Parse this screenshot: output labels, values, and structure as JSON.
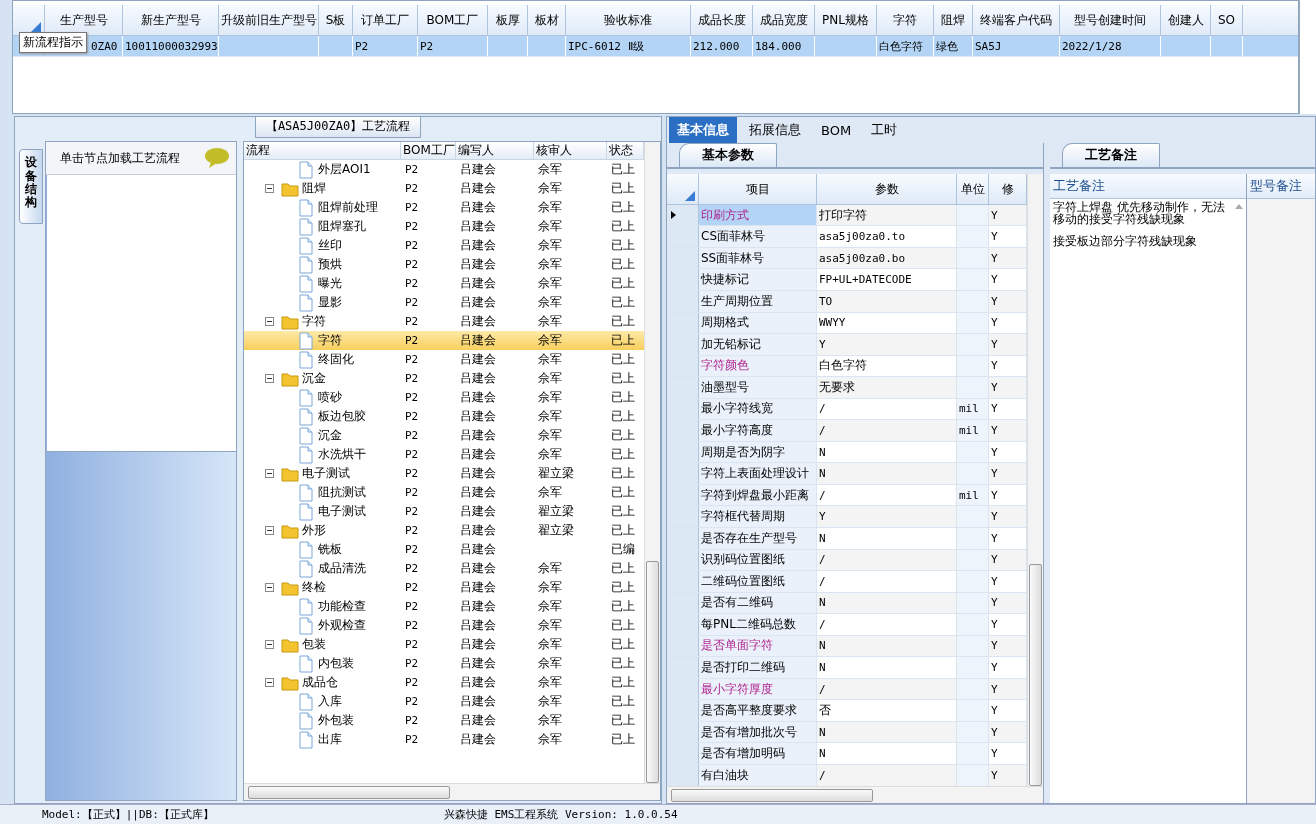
{
  "grid": {
    "columns": [
      "生产型号",
      "新生产型号",
      "升级前旧生产型号",
      "S板",
      "订单工厂",
      "BOM工厂",
      "板厚",
      "板材",
      "验收标准",
      "成品长度",
      "成品宽度",
      "PNL规格",
      "字符",
      "阻焊",
      "终端客户代码",
      "型号创建时间",
      "创建人",
      "SO"
    ],
    "rows": [
      {
        "selected": true,
        "cells": [
          "0ZA0",
          "10011000032993",
          null,
          null,
          "P2",
          "P2",
          null,
          null,
          "IPC-6012 Ⅱ级",
          "212.000",
          "184.000",
          null,
          "白色字符",
          "绿色",
          "SA5J",
          "2022/1/28",
          null,
          null
        ]
      }
    ]
  },
  "tooltip": {
    "text": "新流程指示"
  },
  "flow_panel": {
    "title": "【ASA5J00ZA0】工艺流程",
    "side_tab": "设备结构",
    "hint": "单击节点加载工艺流程",
    "tree": {
      "columns": [
        "流程",
        "BOM工厂",
        "编写人",
        "核审人",
        "状态"
      ],
      "rows": [
        {
          "children": [
            {
              "label": "外层AOI1",
              "bom": "P2",
              "author": "吕建会",
              "reviewer": "佘军",
              "status": "已上",
              "selected": false
            }
          ]
        },
        {
          "label": "阻焊",
          "bom": "P2",
          "author": "吕建会",
          "reviewer": "佘军",
          "status": "已上",
          "selected": false,
          "expanded": true,
          "children": [
            {
              "label": "阻焊前处理",
              "bom": "P2",
              "author": "吕建会",
              "reviewer": "佘军",
              "status": "已上",
              "selected": false
            },
            {
              "label": "阻焊塞孔",
              "bom": "P2",
              "author": "吕建会",
              "reviewer": "佘军",
              "status": "已上",
              "selected": false
            },
            {
              "label": "丝印",
              "bom": "P2",
              "author": "吕建会",
              "reviewer": "佘军",
              "status": "已上",
              "selected": false
            },
            {
              "label": "预烘",
              "bom": "P2",
              "author": "吕建会",
              "reviewer": "佘军",
              "status": "已上",
              "selected": false
            },
            {
              "label": "曝光",
              "bom": "P2",
              "author": "吕建会",
              "reviewer": "佘军",
              "status": "已上",
              "selected": false
            },
            {
              "label": "显影",
              "bom": "P2",
              "author": "吕建会",
              "reviewer": "佘军",
              "status": "已上",
              "selected": false
            }
          ]
        },
        {
          "label": "字符",
          "bom": "P2",
          "author": "吕建会",
          "reviewer": "佘军",
          "status": "已上",
          "selected": false,
          "expanded": true,
          "children": [
            {
              "label": "字符",
              "bom": "P2",
              "author": "吕建会",
              "reviewer": "佘军",
              "status": "已上",
              "selected": true
            },
            {
              "label": "终固化",
              "bom": "P2",
              "author": "吕建会",
              "reviewer": "佘军",
              "status": "已上",
              "selected": false
            }
          ]
        },
        {
          "label": "沉金",
          "bom": "P2",
          "author": "吕建会",
          "reviewer": "佘军",
          "status": "已上",
          "selected": false,
          "expanded": true,
          "children": [
            {
              "label": "喷砂",
              "bom": "P2",
              "author": "吕建会",
              "reviewer": "佘军",
              "status": "已上",
              "selected": false
            },
            {
              "label": "板边包胶",
              "bom": "P2",
              "author": "吕建会",
              "reviewer": "佘军",
              "status": "已上",
              "selected": false
            },
            {
              "label": "沉金",
              "bom": "P2",
              "author": "吕建会",
              "reviewer": "佘军",
              "status": "已上",
              "selected": false
            },
            {
              "label": "水洗烘干",
              "bom": "P2",
              "author": "吕建会",
              "reviewer": "佘军",
              "status": "已上",
              "selected": false
            }
          ]
        },
        {
          "label": "电子测试",
          "bom": "P2",
          "author": "吕建会",
          "reviewer": "翟立梁",
          "status": "已上",
          "selected": false,
          "expanded": true,
          "children": [
            {
              "label": "阻抗测试",
              "bom": "P2",
              "author": "吕建会",
              "reviewer": "佘军",
              "status": "已上",
              "selected": false
            },
            {
              "label": "电子测试",
              "bom": "P2",
              "author": "吕建会",
              "reviewer": "翟立梁",
              "status": "已上",
              "selected": false
            }
          ]
        },
        {
          "label": "外形",
          "bom": "P2",
          "author": "吕建会",
          "reviewer": "翟立梁",
          "status": "已上",
          "selected": false,
          "expanded": true,
          "children": [
            {
              "label": "铣板",
              "bom": "P2",
              "author": "吕建会",
              "status": "已编",
              "selected": false
            },
            {
              "label": "成品清洗",
              "bom": "P2",
              "author": "吕建会",
              "reviewer": "佘军",
              "status": "已上",
              "selected": false
            }
          ]
        },
        {
          "label": "终检",
          "bom": "P2",
          "author": "吕建会",
          "reviewer": "佘军",
          "status": "已上",
          "selected": false,
          "expanded": true,
          "children": [
            {
              "label": "功能检查",
              "bom": "P2",
              "author": "吕建会",
              "reviewer": "佘军",
              "status": "已上",
              "selected": false
            },
            {
              "label": "外观检查",
              "bom": "P2",
              "author": "吕建会",
              "reviewer": "佘军",
              "status": "已上",
              "selected": false
            }
          ]
        },
        {
          "label": "包装",
          "bom": "P2",
          "author": "吕建会",
          "reviewer": "佘军",
          "status": "已上",
          "selected": false,
          "expanded": true,
          "children": [
            {
              "label": "内包装",
              "bom": "P2",
              "author": "吕建会",
              "reviewer": "佘军",
              "status": "已上",
              "selected": false
            }
          ]
        },
        {
          "label": "成品仓",
          "bom": "P2",
          "author": "吕建会",
          "reviewer": "佘军",
          "status": "已上",
          "selected": false,
          "expanded": true,
          "children": [
            {
              "label": "入库",
              "bom": "P2",
              "author": "吕建会",
              "reviewer": "佘军",
              "status": "已上",
              "selected": false
            },
            {
              "label": "外包装",
              "bom": "P2",
              "author": "吕建会",
              "reviewer": "佘军",
              "status": "已上",
              "selected": false
            },
            {
              "label": "出库",
              "bom": "P2",
              "author": "吕建会",
              "reviewer": "佘军",
              "status": "已上",
              "selected": false
            }
          ]
        }
      ]
    }
  },
  "detail": {
    "tabs": [
      {
        "label": "基本信息",
        "selected": true
      },
      {
        "label": "拓展信息",
        "selected": false
      },
      {
        "label": "BOM",
        "selected": false
      },
      {
        "label": "工时",
        "selected": false
      }
    ],
    "params": {
      "tab": "基本参数",
      "columns": [
        "项目",
        "参数",
        "单位",
        "修"
      ],
      "rows": [
        {
          "item": "印刷方式",
          "value": "打印字符",
          "modified": "Y",
          "highlighted": true,
          "selected": true
        },
        {
          "item": "CS面菲林号",
          "value": "asa5j00za0.to",
          "modified": "Y",
          "highlighted": false,
          "selected": false
        },
        {
          "item": "SS面菲林号",
          "value": "asa5j00za0.bo",
          "modified": "Y",
          "highlighted": false,
          "selected": false
        },
        {
          "item": "快捷标记",
          "value": "FP+UL+DATECODE",
          "modified": "Y",
          "highlighted": false,
          "selected": false
        },
        {
          "item": "生产周期位置",
          "value": "TO",
          "modified": "Y",
          "highlighted": false,
          "selected": false
        },
        {
          "item": "周期格式",
          "value": "WWYY",
          "modified": "Y",
          "highlighted": false,
          "selected": false
        },
        {
          "item": "加无铅标记",
          "value": "Y",
          "modified": "Y",
          "highlighted": false,
          "selected": false
        },
        {
          "item": "字符颜色",
          "value": "白色字符",
          "modified": "Y",
          "highlighted": true,
          "selected": false
        },
        {
          "item": "油墨型号",
          "value": "无要求",
          "modified": "Y",
          "highlighted": false,
          "selected": false
        },
        {
          "item": "最小字符线宽",
          "value": "/",
          "unit": "mil",
          "modified": "Y",
          "highlighted": false,
          "selected": false
        },
        {
          "item": "最小字符高度",
          "value": "/",
          "unit": "mil",
          "modified": "Y",
          "highlighted": false,
          "selected": false
        },
        {
          "item": "周期是否为阴字",
          "value": "N",
          "modified": "Y",
          "highlighted": false,
          "selected": false
        },
        {
          "item": "字符上表面处理设计",
          "value": "N",
          "modified": "Y",
          "highlighted": false,
          "selected": false
        },
        {
          "item": "字符到焊盘最小距离",
          "value": "/",
          "unit": "mil",
          "modified": "Y",
          "highlighted": false,
          "selected": false
        },
        {
          "item": "字符框代替周期",
          "value": "Y",
          "modified": "Y",
          "highlighted": false,
          "selected": false
        },
        {
          "item": "是否存在生产型号",
          "value": "N",
          "modified": "Y",
          "highlighted": false,
          "selected": false
        },
        {
          "item": "识别码位置图纸",
          "value": "/",
          "modified": "Y",
          "highlighted": false,
          "selected": false
        },
        {
          "item": "二维码位置图纸",
          "value": "/",
          "modified": "Y",
          "highlighted": false,
          "selected": false
        },
        {
          "item": "是否有二维码",
          "value": "N",
          "modified": "Y",
          "highlighted": false,
          "selected": false
        },
        {
          "item": "每PNL二维码总数",
          "value": "/",
          "modified": "Y",
          "highlighted": false,
          "selected": false
        },
        {
          "item": "是否单面字符",
          "value": "N",
          "modified": "Y",
          "highlighted": true,
          "selected": false
        },
        {
          "item": "是否打印二维码",
          "value": "N",
          "modified": "Y",
          "highlighted": false,
          "selected": false
        },
        {
          "item": "最小字符厚度",
          "value": "/",
          "modified": "Y",
          "highlighted": true,
          "selected": false
        },
        {
          "item": "是否高平整度要求",
          "value": "否",
          "modified": "Y",
          "highlighted": false,
          "selected": false
        },
        {
          "item": "是否有增加批次号",
          "value": "N",
          "modified": "Y",
          "highlighted": false,
          "selected": false
        },
        {
          "item": "是否有增加明码",
          "value": "N",
          "modified": "Y",
          "highlighted": false,
          "selected": false
        },
        {
          "item": "有白油块",
          "value": "/",
          "modified": "Y",
          "highlighted": false,
          "selected": false
        }
      ]
    },
    "notes": {
      "tab": "工艺备注",
      "columns": [
        "工艺备注",
        "型号备注"
      ],
      "paragraphs": [
        "字符上焊盘 优先移动制作，无法移动的接受字符残缺现象",
        "接受板边部分字符残缺现象"
      ]
    }
  },
  "status_bar": {
    "model": "Model:【正式】||DB:【正式库】",
    "app": "兴森快捷 EMS工程系统 Version: 1.0.0.54"
  }
}
